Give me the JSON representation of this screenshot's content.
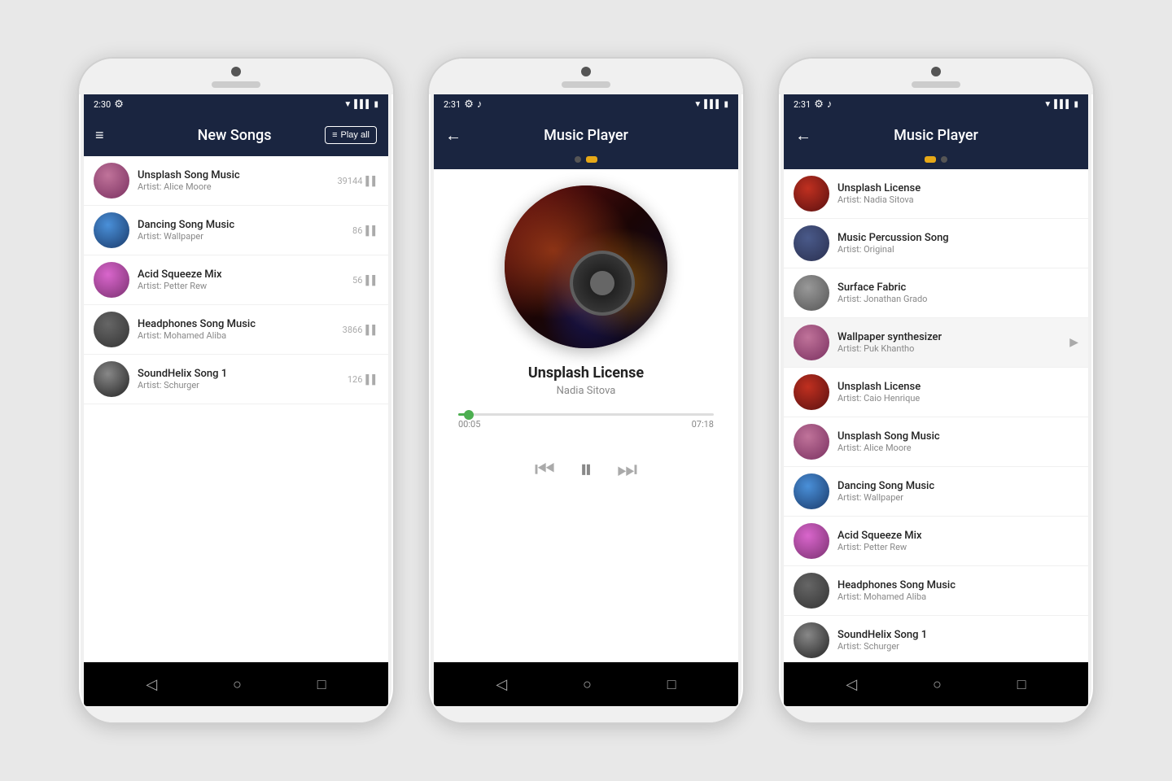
{
  "phone1": {
    "statusBar": {
      "time": "2:30",
      "gearIcon": "⚙",
      "wifiIcon": "▼",
      "signalIcon": "▌▌▌",
      "batteryIcon": "▮"
    },
    "appBar": {
      "hamburgerIcon": "≡",
      "title": "New Songs",
      "playAllLabel": "Play all"
    },
    "songs": [
      {
        "title": "Unsplash Song Music",
        "artist": "Alice Moore",
        "count": "39144",
        "thumbClass": "thumb-1"
      },
      {
        "title": "Dancing Song Music",
        "artist": "Wallpaper",
        "count": "86",
        "thumbClass": "thumb-2"
      },
      {
        "title": "Acid Squeeze Mix",
        "artist": "Petter Rew",
        "count": "56",
        "thumbClass": "thumb-3"
      },
      {
        "title": "Headphones Song Music",
        "artist": "Mohamed Aliba",
        "count": "3866",
        "thumbClass": "thumb-4"
      },
      {
        "title": "SoundHelix Song 1",
        "artist": "Schurger",
        "count": "126",
        "thumbClass": "thumb-5"
      }
    ],
    "artistLabel": "Artist: ",
    "navBack": "◁",
    "navHome": "○",
    "navSquare": "□"
  },
  "phone2": {
    "statusBar": {
      "time": "2:31",
      "gearIcon": "⚙",
      "musicIcon": "♪",
      "wifiIcon": "▼",
      "signalIcon": "▌▌▌",
      "batteryIcon": "▮"
    },
    "appBar": {
      "backIcon": "←",
      "title": "Music Player"
    },
    "tabs": [
      {
        "active": false
      },
      {
        "active": true
      }
    ],
    "player": {
      "songName": "Unsplash License",
      "artist": "Nadia Sitova",
      "currentTime": "00:05",
      "totalTime": "07:18",
      "progressPercent": 4
    },
    "navBack": "◁",
    "navHome": "○",
    "navSquare": "□"
  },
  "phone3": {
    "statusBar": {
      "time": "2:31",
      "gearIcon": "⚙",
      "musicIcon": "♪",
      "wifiIcon": "▼",
      "signalIcon": "▌▌▌",
      "batteryIcon": "▮"
    },
    "appBar": {
      "backIcon": "←",
      "title": "Music Player"
    },
    "tabs": [
      {
        "active": true
      },
      {
        "active": false
      }
    ],
    "songs": [
      {
        "title": "Unsplash License",
        "artist": "Nadia Sitova",
        "thumbClass": "thumb-6",
        "active": false
      },
      {
        "title": "Music Percussion Song",
        "artist": "Original",
        "thumbClass": "thumb-7",
        "active": false
      },
      {
        "title": "Surface Fabric",
        "artist": "Jonathan Grado",
        "thumbClass": "thumb-8",
        "active": false
      },
      {
        "title": "Wallpaper synthesizer",
        "artist": "Puk Khantho",
        "thumbClass": "thumb-9",
        "active": true
      },
      {
        "title": "Unsplash License",
        "artist": "Caio Henrique",
        "thumbClass": "thumb-6",
        "active": false
      },
      {
        "title": "Unsplash Song Music",
        "artist": "Alice Moore",
        "thumbClass": "thumb-1",
        "active": false
      },
      {
        "title": "Dancing Song Music",
        "artist": "Wallpaper",
        "thumbClass": "thumb-2",
        "active": false
      },
      {
        "title": "Acid Squeeze Mix",
        "artist": "Petter Rew",
        "thumbClass": "thumb-3",
        "active": false
      },
      {
        "title": "Headphones Song Music",
        "artist": "Mohamed Aliba",
        "thumbClass": "thumb-4",
        "active": false
      },
      {
        "title": "SoundHelix Song 1",
        "artist": "Schurger",
        "thumbClass": "thumb-5",
        "active": false
      }
    ],
    "artistLabel": "Artist: ",
    "navBack": "◁",
    "navHome": "○",
    "navSquare": "□"
  }
}
